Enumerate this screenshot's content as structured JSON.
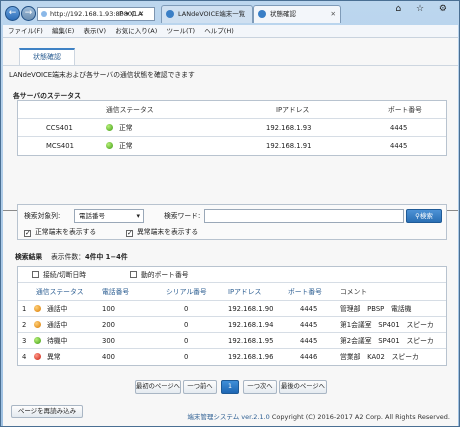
{
  "browser": {
    "address": "http://192.168.1.93:8080/LA",
    "address_tail": "P ▾ C ✕",
    "tabs": [
      {
        "label": "LANdeVOICE端末一覧"
      },
      {
        "label": "状態確認"
      }
    ],
    "window_controls": "⌂ ☆ ⚙",
    "menu": [
      "ファイル(F)",
      "編集(E)",
      "表示(V)",
      "お気に入り(A)",
      "ツール(T)",
      "ヘルプ(H)"
    ]
  },
  "page": {
    "tab_label": "状態確認",
    "description": "LANdeVOICE端末および各サーバの通信状態を確認できます"
  },
  "servers": {
    "heading": "各サーバのステータス",
    "columns": [
      "通信ステータス",
      "IPアドレス",
      "ポート番号"
    ],
    "rows": [
      {
        "name": "CCS401",
        "status": "正常",
        "status_color": "#3d9b12",
        "ip": "192.168.1.93",
        "port": "4445"
      },
      {
        "name": "MCS401",
        "status": "正常",
        "status_color": "#3d9b12",
        "ip": "192.168.1.91",
        "port": "4445"
      }
    ]
  },
  "search": {
    "target_label": "検索対象列:",
    "target_value": "電話番号",
    "keyword_label": "検索ワード:",
    "keyword_value": "",
    "button_label": "検索",
    "show_normal_label": "正常端末を表示する",
    "show_normal_checked": true,
    "show_abnormal_label": "異常端末を表示する",
    "show_abnormal_checked": true
  },
  "results": {
    "heading": "検索結果",
    "count_text": "表示件数：",
    "count_value": "4件中 1−4件",
    "option_connect_time": "接続/切断日時",
    "option_dynamic_port": "動的ポート番号",
    "columns": [
      "通信ステータス",
      "電話番号",
      "シリアル番号",
      "IPアドレス",
      "ポート番号",
      "コメント"
    ],
    "rows": [
      {
        "no": "1",
        "status": "通話中",
        "color": "orange",
        "phone": "100",
        "serial": "0",
        "ip": "192.168.1.90",
        "port": "4445",
        "comment": "管理部　PBSP　電話機"
      },
      {
        "no": "2",
        "status": "通話中",
        "color": "orange",
        "phone": "200",
        "serial": "0",
        "ip": "192.168.1.94",
        "port": "4445",
        "comment": "第1会議室　SP401　スピーカ"
      },
      {
        "no": "3",
        "status": "待機中",
        "color": "green",
        "phone": "300",
        "serial": "0",
        "ip": "192.168.1.95",
        "port": "4445",
        "comment": "第2会議室　SP401　スピーカ"
      },
      {
        "no": "4",
        "status": "異常",
        "color": "red",
        "phone": "400",
        "serial": "0",
        "ip": "192.168.1.96",
        "port": "4446",
        "comment": "営業部　KA02　スピーカ"
      }
    ]
  },
  "pager": {
    "first": "最初のページへ",
    "prev": "一つ前へ",
    "current": "1",
    "next": "一つ次へ",
    "last": "最後のページへ"
  },
  "footer": {
    "reload": "ページを再読み込み",
    "product": "端末管理システム",
    "version": "ver.2.1.0",
    "copyright": "Copyright (C) 2016-2017 A2 Corp. All Rights Reserved."
  }
}
